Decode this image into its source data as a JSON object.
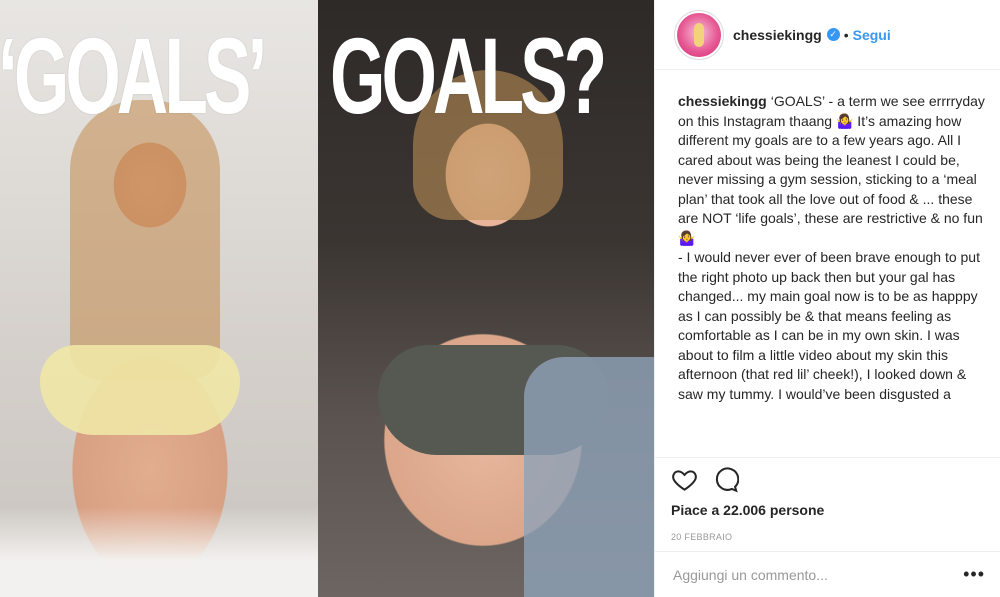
{
  "image": {
    "left_overlay": "‘GOALS’",
    "right_overlay": "GOALS?"
  },
  "post": {
    "username": "chessiekingg",
    "verified_icon": "verified-badge-icon",
    "separator": "•",
    "follow_label": "Segui",
    "caption_user": "chessiekingg",
    "caption_text": "‘GOALS’ - a term we see errrryday on this Instagram thaang 🤷‍♀️ It’s amazing how different my goals are to a few years ago. All I cared about was being the leanest I could be, never missing a gym session, sticking to a ‘meal plan’ that took all the love out of food & ... these are NOT ‘life goals’, these are restrictive & no fun 🤷‍♀️\n- I would never ever of been brave enough to put the right photo up back then but your gal has changed... my main goal now is to be as happpy as I can possibly be & that means feeling as comfortable as I can be in my own skin. I was about to film a little video about my skin this afternoon (that red lil’ cheek!), I looked down & saw my tummy. I would’ve been disgusted a",
    "likes": "Piace a 22.006 persone",
    "date": "20 FEBBRAIO",
    "comment_placeholder": "Aggiungi un commento...",
    "more_label": "•••"
  },
  "colors": {
    "accent": "#3897f0",
    "text": "#262626",
    "muted": "#999999"
  }
}
